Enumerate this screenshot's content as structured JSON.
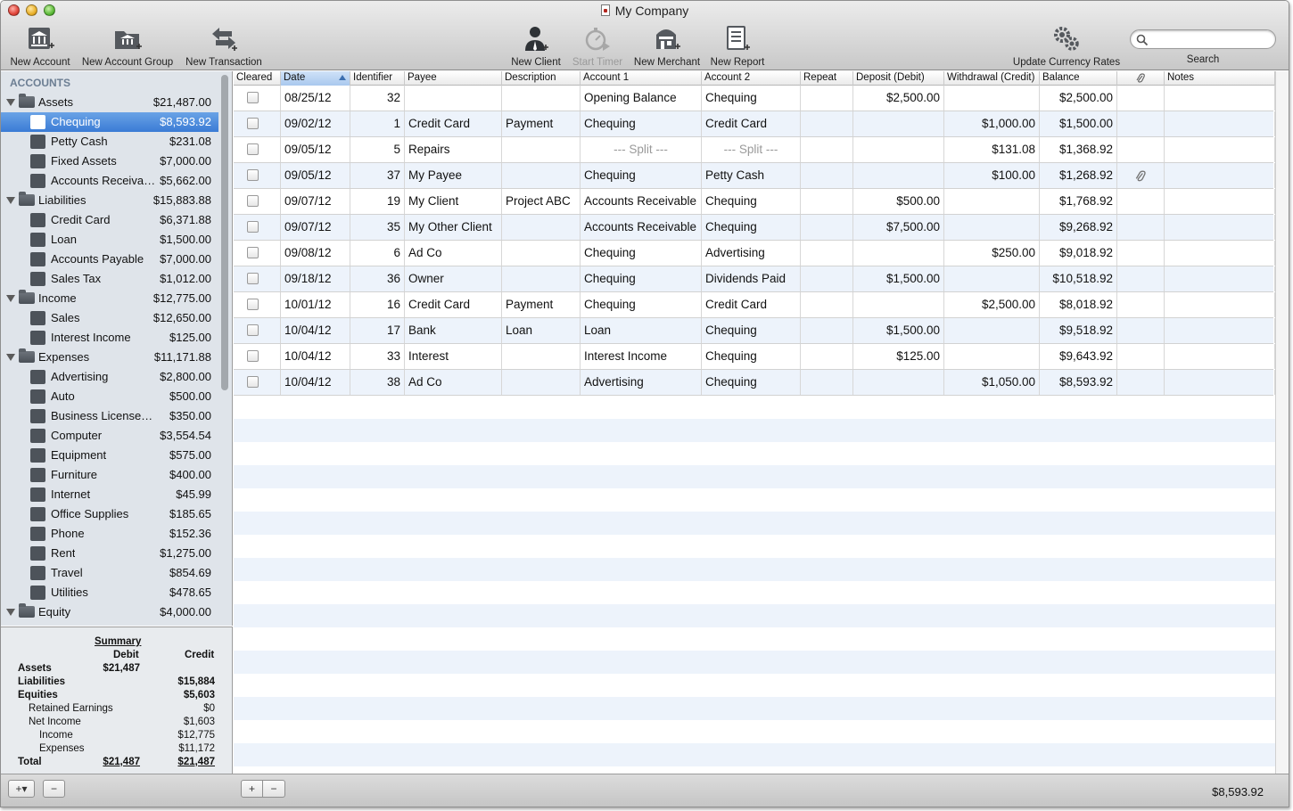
{
  "window": {
    "title": "My Company"
  },
  "toolbar": {
    "new_account": "New Account",
    "new_account_group": "New Account Group",
    "new_transaction": "New Transaction",
    "new_client": "New Client",
    "start_timer": "Start Timer",
    "new_merchant": "New Merchant",
    "new_report": "New Report",
    "update_currency_rates": "Update Currency Rates",
    "search_label": "Search",
    "search_placeholder": ""
  },
  "sidebar": {
    "heading": "ACCOUNTS",
    "groups": [
      {
        "name": "Assets",
        "value": "$21,487.00",
        "accounts": [
          {
            "name": "Chequing",
            "value": "$8,593.92",
            "selected": true
          },
          {
            "name": "Petty Cash",
            "value": "$231.08"
          },
          {
            "name": "Fixed Assets",
            "value": "$7,000.00"
          },
          {
            "name": "Accounts Receivable",
            "value": "$5,662.00"
          }
        ]
      },
      {
        "name": "Liabilities",
        "value": "$15,883.88",
        "accounts": [
          {
            "name": "Credit Card",
            "value": "$6,371.88"
          },
          {
            "name": "Loan",
            "value": "$1,500.00"
          },
          {
            "name": "Accounts Payable",
            "value": "$7,000.00"
          },
          {
            "name": "Sales Tax",
            "value": "$1,012.00"
          }
        ]
      },
      {
        "name": "Income",
        "value": "$12,775.00",
        "accounts": [
          {
            "name": "Sales",
            "value": "$12,650.00"
          },
          {
            "name": "Interest Income",
            "value": "$125.00"
          }
        ]
      },
      {
        "name": "Expenses",
        "value": "$11,171.88",
        "accounts": [
          {
            "name": "Advertising",
            "value": "$2,800.00"
          },
          {
            "name": "Auto",
            "value": "$500.00"
          },
          {
            "name": "Business Licenses/...",
            "value": "$350.00"
          },
          {
            "name": "Computer",
            "value": "$3,554.54"
          },
          {
            "name": "Equipment",
            "value": "$575.00"
          },
          {
            "name": "Furniture",
            "value": "$400.00"
          },
          {
            "name": "Internet",
            "value": "$45.99"
          },
          {
            "name": "Office Supplies",
            "value": "$185.65"
          },
          {
            "name": "Phone",
            "value": "$152.36"
          },
          {
            "name": "Rent",
            "value": "$1,275.00"
          },
          {
            "name": "Travel",
            "value": "$854.69"
          },
          {
            "name": "Utilities",
            "value": "$478.65"
          }
        ]
      },
      {
        "name": "Equity",
        "value": "$4,000.00",
        "accounts": []
      }
    ]
  },
  "summary": {
    "title": "Summary",
    "debit_header": "Debit",
    "credit_header": "Credit",
    "rows": [
      {
        "label": "Assets",
        "debit": "$21,487",
        "credit": "",
        "bold": true
      },
      {
        "label": "Liabilities",
        "debit": "",
        "credit": "$15,884",
        "bold": true
      },
      {
        "label": "Equities",
        "debit": "",
        "credit": "$5,603",
        "bold": true
      },
      {
        "label": "Retained Earnings",
        "debit": "",
        "credit": "$0"
      },
      {
        "label": "Net Income",
        "debit": "",
        "credit": "$1,603"
      },
      {
        "label": "Income",
        "debit": "",
        "credit": "$12,775"
      },
      {
        "label": "Expenses",
        "debit": "",
        "credit": "$11,172"
      },
      {
        "label": "Total",
        "debit": "$21,487",
        "credit": "$21,487",
        "bold": true
      }
    ]
  },
  "table": {
    "columns": [
      "Cleared",
      "Date",
      "Identifier",
      "Payee",
      "Description",
      "Account 1",
      "Account 2",
      "Repeat",
      "Deposit (Debit)",
      "Withdrawal (Credit)",
      "Balance",
      "paperclip-icon",
      "Notes"
    ],
    "rows": [
      {
        "date": "08/25/12",
        "id": "32",
        "payee": "",
        "desc": "",
        "acct1": "Opening Balance",
        "acct2": "Chequing",
        "deposit": "$2,500.00",
        "withdrawal": "",
        "balance": "$2,500.00"
      },
      {
        "date": "09/02/12",
        "id": "1",
        "payee": "Credit Card",
        "desc": "Payment",
        "acct1": "Chequing",
        "acct2": "Credit Card",
        "deposit": "",
        "withdrawal": "$1,000.00",
        "balance": "$1,500.00"
      },
      {
        "date": "09/05/12",
        "id": "5",
        "payee": "Repairs",
        "desc": "",
        "acct1": "--- Split ---",
        "acct2": "--- Split ---",
        "split": true,
        "deposit": "",
        "withdrawal": "$131.08",
        "balance": "$1,368.92"
      },
      {
        "date": "09/05/12",
        "id": "37",
        "payee": "My Payee",
        "desc": "",
        "acct1": "Chequing",
        "acct2": "Petty Cash",
        "deposit": "",
        "withdrawal": "$100.00",
        "balance": "$1,268.92",
        "attachment": true
      },
      {
        "date": "09/07/12",
        "id": "19",
        "payee": "My Client",
        "desc": "Project ABC",
        "acct1": "Accounts Receivable",
        "acct2": "Chequing",
        "deposit": "$500.00",
        "withdrawal": "",
        "balance": "$1,768.92"
      },
      {
        "date": "09/07/12",
        "id": "35",
        "payee": "My Other Client",
        "desc": "",
        "acct1": "Accounts Receivable",
        "acct2": "Chequing",
        "deposit": "$7,500.00",
        "withdrawal": "",
        "balance": "$9,268.92"
      },
      {
        "date": "09/08/12",
        "id": "6",
        "payee": "Ad Co",
        "desc": "",
        "acct1": "Chequing",
        "acct2": "Advertising",
        "deposit": "",
        "withdrawal": "$250.00",
        "balance": "$9,018.92"
      },
      {
        "date": "09/18/12",
        "id": "36",
        "payee": "Owner",
        "desc": "",
        "acct1": "Chequing",
        "acct2": "Dividends Paid",
        "deposit": "$1,500.00",
        "withdrawal": "",
        "balance": "$10,518.92"
      },
      {
        "date": "10/01/12",
        "id": "16",
        "payee": "Credit Card",
        "desc": "Payment",
        "acct1": "Chequing",
        "acct2": "Credit Card",
        "deposit": "",
        "withdrawal": "$2,500.00",
        "balance": "$8,018.92"
      },
      {
        "date": "10/04/12",
        "id": "17",
        "payee": "Bank",
        "desc": "Loan",
        "acct1": "Loan",
        "acct2": "Chequing",
        "deposit": "$1,500.00",
        "withdrawal": "",
        "balance": "$9,518.92"
      },
      {
        "date": "10/04/12",
        "id": "33",
        "payee": "Interest",
        "desc": "",
        "acct1": "Interest Income",
        "acct2": "Chequing",
        "deposit": "$125.00",
        "withdrawal": "",
        "balance": "$9,643.92"
      },
      {
        "date": "10/04/12",
        "id": "38",
        "payee": "Ad Co",
        "desc": "",
        "acct1": "Advertising",
        "acct2": "Chequing",
        "deposit": "",
        "withdrawal": "$1,050.00",
        "balance": "$8,593.92"
      }
    ]
  },
  "bottom": {
    "add_label": "+▾",
    "remove_label": "−",
    "table_add_label": "+",
    "table_remove_label": "−",
    "footer_balance": "$8,593.92"
  },
  "colors": {
    "selection": "#3a7bd5",
    "sidebar_bg": "#dfe4ea",
    "row_alt": "#edf3fb"
  }
}
